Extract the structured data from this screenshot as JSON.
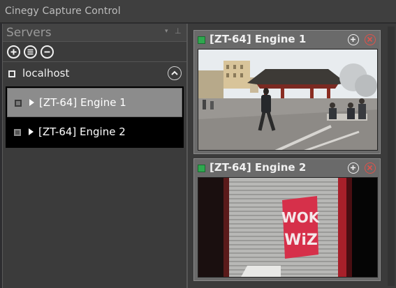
{
  "window": {
    "title": "Cinegy Capture Control"
  },
  "servers_panel": {
    "title": "Servers",
    "dropdown_glyph": "▾",
    "pin_glyph": "⊥",
    "toolbar": [
      {
        "name": "add-server-button",
        "icon": "plus-circle-icon"
      },
      {
        "name": "server-menu-button",
        "icon": "list-circle-icon"
      },
      {
        "name": "remove-server-button",
        "icon": "minus-circle-icon"
      }
    ],
    "host": {
      "label": "localhost",
      "expanded": true
    },
    "engines": [
      {
        "label": "[ZT-64] Engine 1",
        "selected": true
      },
      {
        "label": "[ZT-64] Engine 2",
        "selected": false
      }
    ]
  },
  "engine_cards": [
    {
      "title": "[ZT-64] Engine 1",
      "status": "running",
      "status_color": "#2fa84f",
      "preview": "street-plaza-scene"
    },
    {
      "title": "[ZT-64] Engine 2",
      "status": "running",
      "status_color": "#2fa84f",
      "preview": "wok-wiz-shutter-scene",
      "sign_line1": "WOK",
      "sign_line2": "WiZ"
    }
  ],
  "colors": {
    "accent_close": "#e0524a",
    "status_green": "#2fa84f",
    "selection": "#8c8c8c"
  }
}
